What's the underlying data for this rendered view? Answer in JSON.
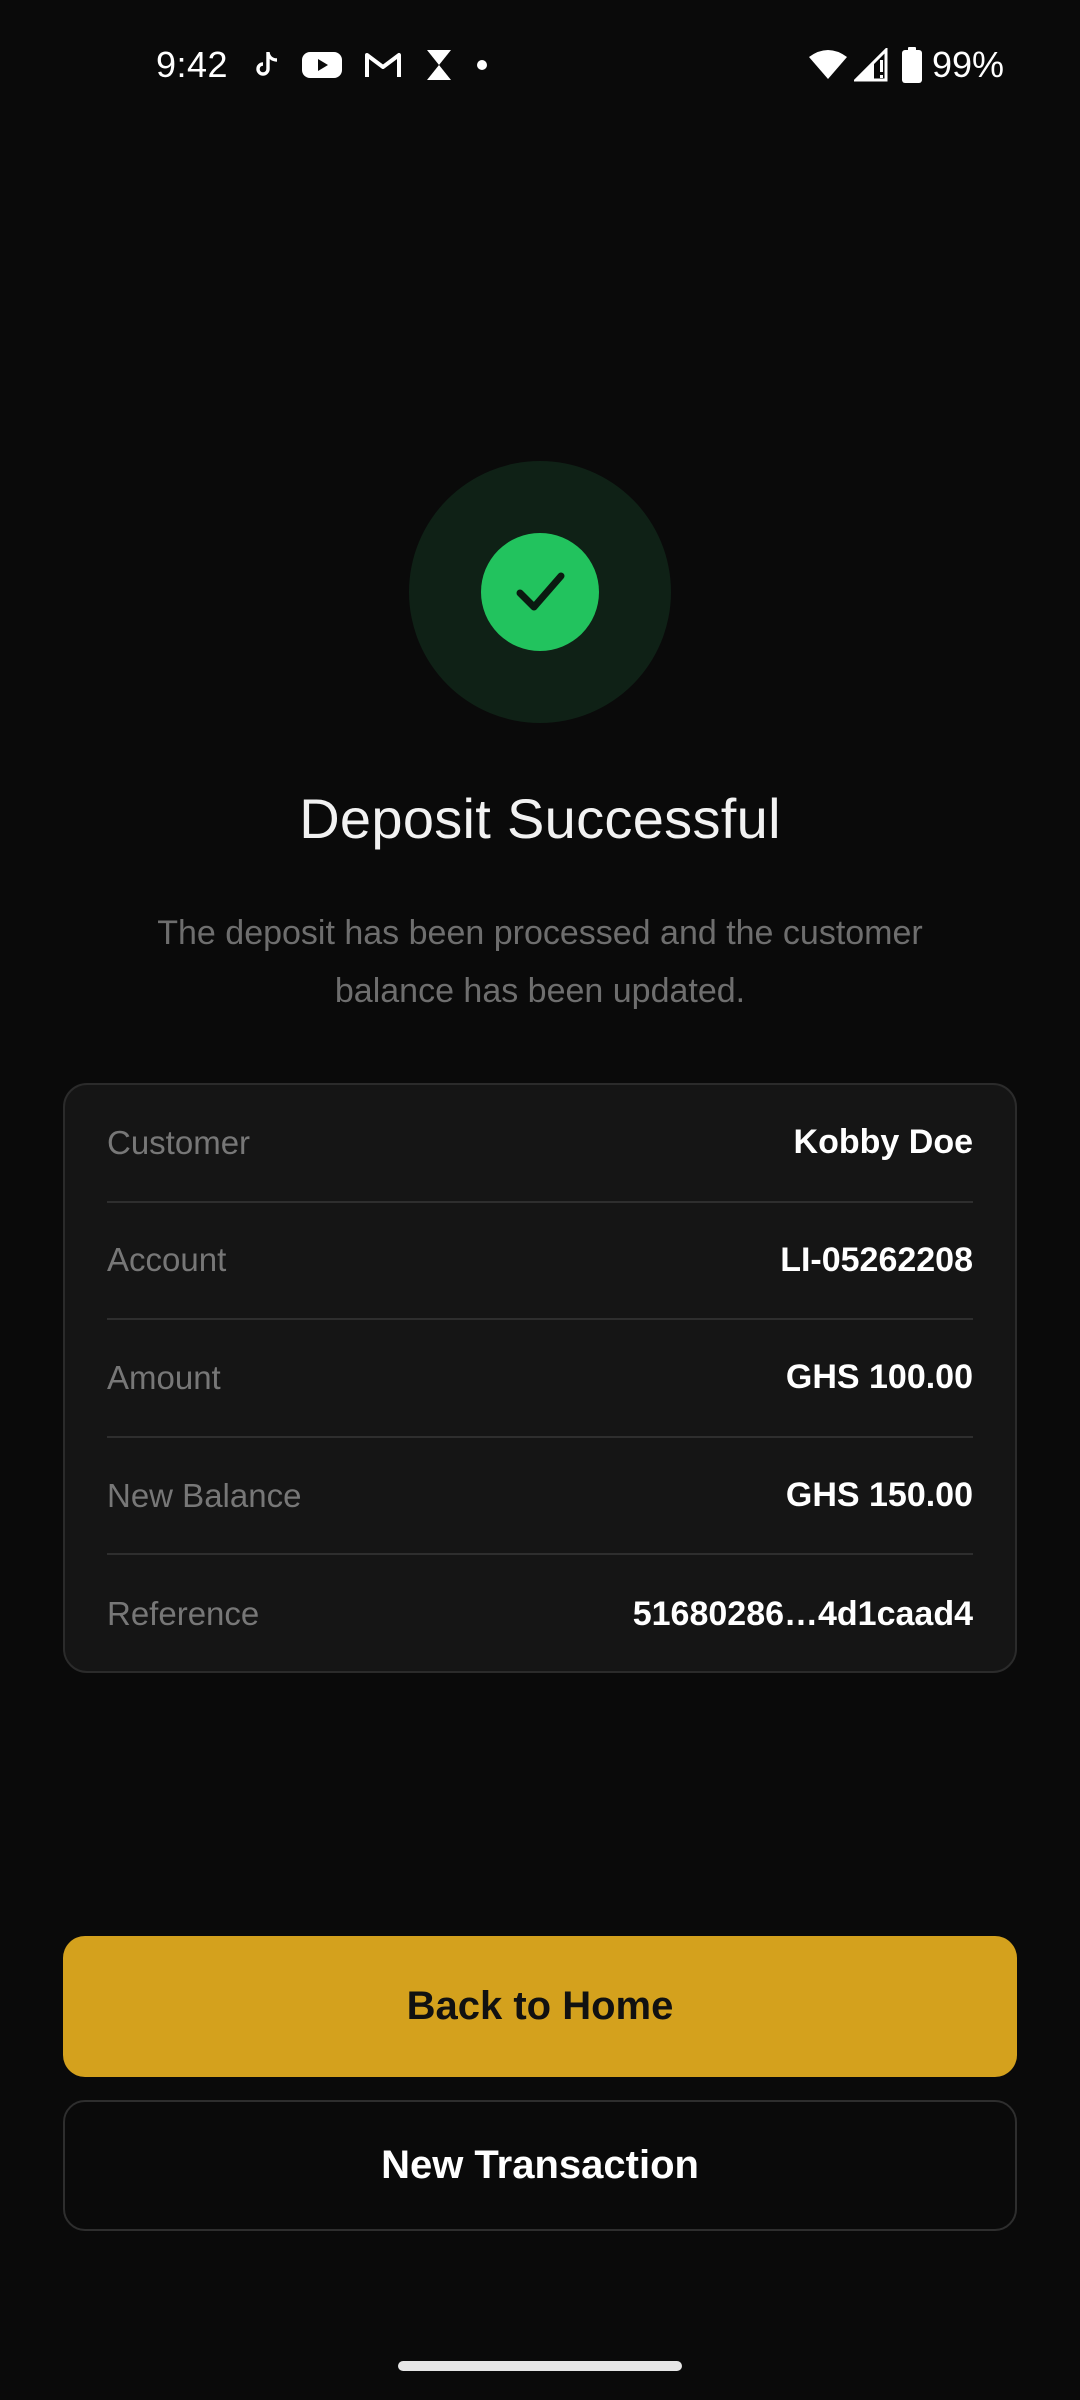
{
  "status_bar": {
    "time": "9:42",
    "battery_percent": "99%",
    "notification_icons": [
      "tiktok-icon",
      "youtube-icon",
      "gmail-icon",
      "hourglass-icon",
      "dot-icon"
    ],
    "system_icons": [
      "wifi-icon",
      "cell-signal-icon",
      "battery-icon"
    ]
  },
  "result": {
    "icon": "check-circle-icon",
    "title": "Deposit Successful",
    "message": "The deposit has been processed and the customer balance has been updated."
  },
  "details": [
    {
      "label": "Customer",
      "value": "Kobby Doe"
    },
    {
      "label": "Account",
      "value": "LI-05262208"
    },
    {
      "label": "Amount",
      "value": "GHS 100.00"
    },
    {
      "label": "New Balance",
      "value": "GHS 150.00"
    },
    {
      "label": "Reference",
      "value": "51680286…4d1caad4"
    }
  ],
  "actions": {
    "primary_label": "Back to Home",
    "secondary_label": "New Transaction"
  },
  "colors": {
    "background": "#0a0a0a",
    "success": "#22c35e",
    "accent": "#d4a11d",
    "card": "#151515"
  }
}
